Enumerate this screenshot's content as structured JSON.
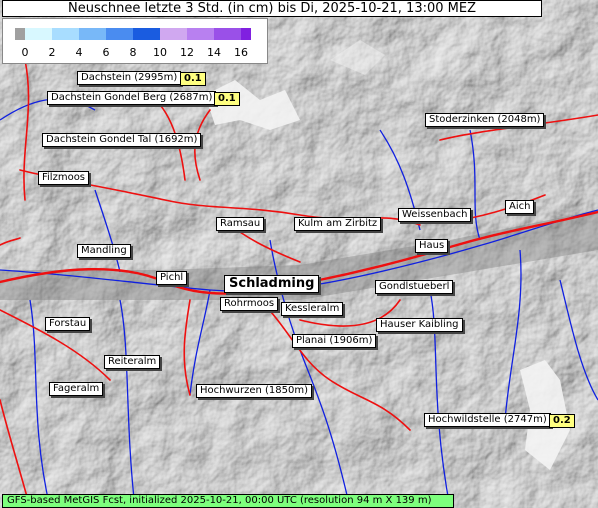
{
  "title": "Neuschnee letzte 3 Std. (in cm) bis Di, 2025-10-21, 13:00 MEZ",
  "legend": {
    "ticks": [
      "0",
      "2",
      "4",
      "6",
      "8",
      "10",
      "12",
      "14",
      "16"
    ],
    "colors": [
      "#a0a0a0",
      "#d8f8ff",
      "#a8ddff",
      "#78b8f8",
      "#4a8cf0",
      "#1a5ce0",
      "#d0a8f0",
      "#b880f0",
      "#9a50e8",
      "#8020e0"
    ]
  },
  "places": [
    {
      "name": "Dachstein (2995m)",
      "value": "0.1"
    },
    {
      "name": "Dachstein Gondel Berg (2687m)",
      "value": "0.1"
    },
    {
      "name": "Dachstein Gondel Tal (1692m)"
    },
    {
      "name": "Filzmoos"
    },
    {
      "name": "Stoderzinken (2048m)"
    },
    {
      "name": "Ramsau"
    },
    {
      "name": "Kulm am Zirbitz"
    },
    {
      "name": "Weissenbach"
    },
    {
      "name": "Aich"
    },
    {
      "name": "Mandling"
    },
    {
      "name": "Haus"
    },
    {
      "name": "Pichl"
    },
    {
      "name": "Schladming"
    },
    {
      "name": "Gondlstueberl"
    },
    {
      "name": "Rohrmoos"
    },
    {
      "name": "Forstau"
    },
    {
      "name": "Kessleralm"
    },
    {
      "name": "Hauser Kaibling"
    },
    {
      "name": "Planai (1906m)"
    },
    {
      "name": "Reiteralm"
    },
    {
      "name": "Fageralm"
    },
    {
      "name": "Hochwurzen (1850m)"
    },
    {
      "name": "Hochwildstelle (2747m)",
      "value": "0.2"
    }
  ],
  "footer": "GFS-based MetGIS Fcst, initialized 2025-10-21, 00:00 UTC  (resolution 94 m X 139 m)"
}
